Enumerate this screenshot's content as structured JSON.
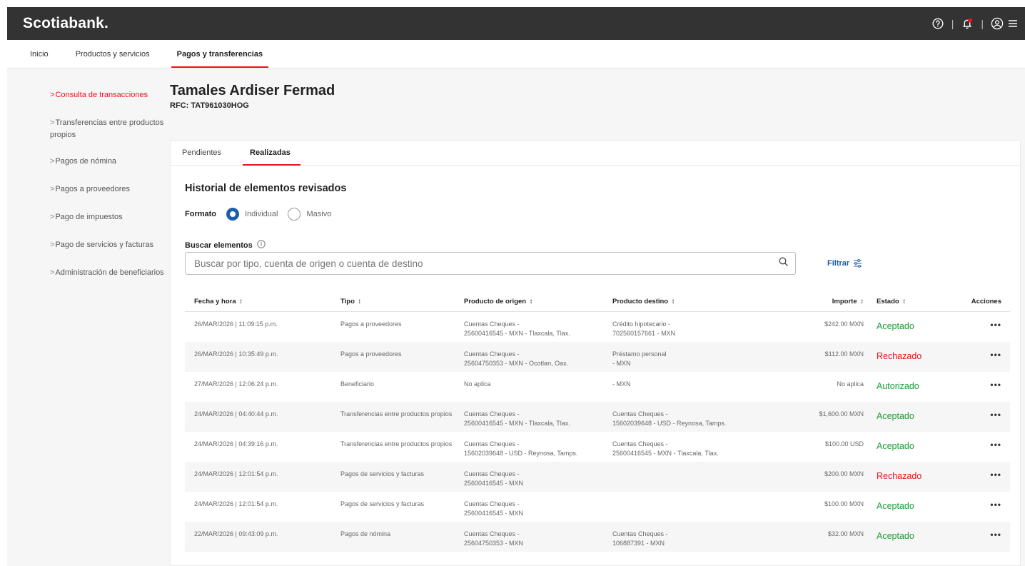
{
  "brand": "Scotiabank.",
  "nav": [
    "Inicio",
    "Productos y servicios",
    "Pagos y transferencias"
  ],
  "sidebar": [
    {
      "label": "Consulta de transacciones"
    },
    {
      "label": "Transferencias entre productos propios"
    },
    {
      "label": "Pagos de nómina"
    },
    {
      "label": "Pagos a proveedores"
    },
    {
      "label": "Pago de impuestos"
    },
    {
      "label": "Pago de servicios y facturas"
    },
    {
      "label": "Administración de beneficiarios"
    }
  ],
  "client": {
    "name": "Tamales Ardiser Fermad",
    "rfc": "RFC: TAT961030HOG"
  },
  "tabs": [
    "Pendientes",
    "Realizadas"
  ],
  "history_title": "Historial de elementos revisados",
  "format": {
    "label": "Formato",
    "options": [
      "Individual",
      "Masivo"
    ],
    "selected": "Individual"
  },
  "search": {
    "label": "Buscar elementos",
    "placeholder": "Buscar por tipo, cuenta de origen o cuenta de destino"
  },
  "filter_label": "Filtrar",
  "table": {
    "headers": [
      "Fecha y hora",
      "Tipo",
      "Producto de origen",
      "Producto destino",
      "Importe",
      "Estado",
      "Acciones"
    ],
    "sort_glyph": "↕",
    "rows": [
      {
        "fecha": "26/MAR/2026 | 11:09:15 p.m.",
        "tipo": "Pagos a proveedores",
        "origen1": "Cuentas Cheques -",
        "origen2": "25600416545 - MXN - Tlaxcala, Tlax.",
        "destino1": "Crédito hipotecario -",
        "destino2": "702560157661 - MXN",
        "importe": "$242.00 MXN",
        "estado": "Aceptado",
        "estado_color": "#1f9e3a"
      },
      {
        "fecha": "26/MAR/2026 | 10:35:49 p.m.",
        "tipo": "Pagos a proveedores",
        "origen1": "Cuentas Cheques -",
        "origen2": "25604750353 - MXN - Ocotlan, Oax.",
        "destino1": "Préstamo personal",
        "destino2": "- MXN",
        "importe": "$112.00 MXN",
        "estado": "Rechazado",
        "estado_color": "#ec111a"
      },
      {
        "fecha": "27/MAR/2026 | 12:06:24 p.m.",
        "tipo": "Beneficiario",
        "origen1": "No aplica",
        "origen2": "",
        "destino1": "- MXN",
        "destino2": "",
        "importe": "No aplica",
        "estado": "Autorizado",
        "estado_color": "#1f9e3a"
      },
      {
        "fecha": "24/MAR/2026 | 04:40:44 p.m.",
        "tipo": "Transferencias entre productos propios",
        "origen1": "Cuentas Cheques -",
        "origen2": "25600416545 - MXN - Tlaxcala, Tlax.",
        "destino1": "Cuentas Cheques -",
        "destino2": "15602039648 - USD - Reynosa, Tamps.",
        "importe": "$1,600.00 MXN",
        "estado": "Aceptado",
        "estado_color": "#1f9e3a"
      },
      {
        "fecha": "24/MAR/2026 | 04:39:16 p.m.",
        "tipo": "Transferencias entre productos propios",
        "origen1": "Cuentas Cheques -",
        "origen2": "15602039648 - USD - Reynosa, Tamps.",
        "destino1": "Cuentas Cheques -",
        "destino2": "25600416545 - MXN - Tlaxcala, Tlax.",
        "importe": "$100.00 USD",
        "estado": "Aceptado",
        "estado_color": "#1f9e3a"
      },
      {
        "fecha": "24/MAR/2026 | 12:01:54 p.m.",
        "tipo": "Pagos de servicios y facturas",
        "origen1": "Cuentas Cheques -",
        "origen2": "25600416545 - MXN",
        "destino1": "",
        "destino2": "",
        "importe": "$200.00 MXN",
        "estado": "Rechazado",
        "estado_color": "#ec111a"
      },
      {
        "fecha": "24/MAR/2026 | 12:01:54 p.m.",
        "tipo": "Pagos de servicios y facturas",
        "origen1": "Cuentas Cheques -",
        "origen2": "25600416545 - MXN",
        "destino1": "",
        "destino2": "",
        "importe": "$100.00 MXN",
        "estado": "Aceptado",
        "estado_color": "#1f9e3a"
      },
      {
        "fecha": "22/MAR/2026 | 09:43:09 p.m.",
        "tipo": "Pagos de nómina",
        "origen1": "Cuentas Cheques -",
        "origen2": "25604750353 - MXN",
        "destino1": "Cuentas Cheques -",
        "destino2": "106887391 - MXN",
        "importe": "$32.00 MXN",
        "estado": "Aceptado",
        "estado_color": "#1f9e3a"
      }
    ],
    "actions_glyph": "•••"
  },
  "icons": [
    "help-icon",
    "notification-bell-icon",
    "user-icon",
    "menu-icon",
    "info-icon",
    "search-icon",
    "filter-icon"
  ],
  "colors": {
    "accent": "#ec111a",
    "link": "#1a5fa8",
    "success": "#1f9e3a",
    "topbar": "#333333"
  }
}
